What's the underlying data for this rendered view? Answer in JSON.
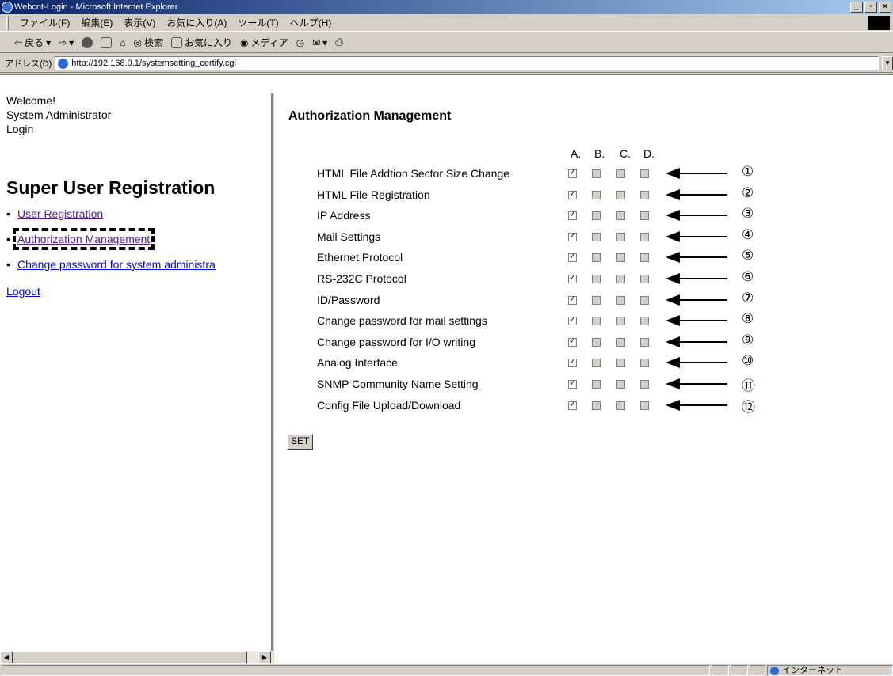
{
  "window": {
    "title": "Webcnt-Login - Microsoft Internet Explorer",
    "min": "_",
    "max": "▫",
    "close": "×"
  },
  "menu": [
    "ファイル(F)",
    "編集(E)",
    "表示(V)",
    "お気に入り(A)",
    "ツール(T)",
    "ヘルプ(H)"
  ],
  "toolbar": {
    "back": "戻る",
    "search": "検索",
    "favorites": "お気に入り",
    "media": "メディア"
  },
  "address": {
    "label": "アドレス(D)",
    "url": "http://192.168.0.1/systemsetting_certify.cgi"
  },
  "left": {
    "welcome": "Welcome!",
    "user": "System Administrator",
    "login": "Login",
    "heading": "Super User Registration",
    "links": [
      "User Registration",
      "Authorization Management",
      "Change password for system administra"
    ],
    "logout": "Logout"
  },
  "right": {
    "heading": "Authorization Management",
    "columns": [
      "A.",
      "B.",
      "C.",
      "D."
    ],
    "rows": [
      {
        "label": "HTML File Addtion Sector Size Change",
        "num": "①",
        "checks": [
          true,
          false,
          false,
          false
        ]
      },
      {
        "label": "HTML File Registration",
        "num": "②",
        "checks": [
          true,
          false,
          false,
          false
        ]
      },
      {
        "label": "IP Address",
        "num": "③",
        "checks": [
          true,
          false,
          false,
          false
        ]
      },
      {
        "label": "Mail Settings",
        "num": "④",
        "checks": [
          true,
          false,
          false,
          false
        ]
      },
      {
        "label": "Ethernet Protocol",
        "num": "⑤",
        "checks": [
          true,
          false,
          false,
          false
        ]
      },
      {
        "label": "RS-232C Protocol",
        "num": "⑥",
        "checks": [
          true,
          false,
          false,
          false
        ]
      },
      {
        "label": "ID/Password",
        "num": "⑦",
        "checks": [
          true,
          false,
          false,
          false
        ]
      },
      {
        "label": "Change password for mail settings",
        "num": "⑧",
        "checks": [
          true,
          false,
          false,
          false
        ]
      },
      {
        "label": "Change password for I/O writing",
        "num": "⑨",
        "checks": [
          true,
          false,
          false,
          false
        ]
      },
      {
        "label": "Analog Interface",
        "num": "⑩",
        "checks": [
          true,
          false,
          false,
          false
        ]
      },
      {
        "label": "SNMP Community Name Setting",
        "num": "⑪",
        "checks": [
          true,
          false,
          false,
          false
        ]
      },
      {
        "label": "Config File Upload/Download",
        "num": "⑫",
        "checks": [
          true,
          false,
          false,
          false
        ]
      }
    ],
    "set_label": "SET"
  },
  "status": {
    "zone": "インターネット"
  }
}
